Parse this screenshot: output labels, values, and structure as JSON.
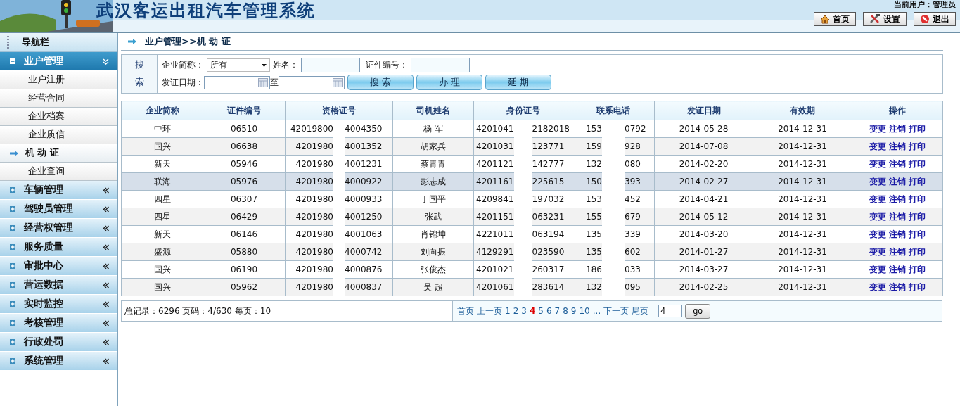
{
  "header": {
    "title": "武汉客运出租汽车管理系统",
    "user": "当前用户：管理员",
    "buttons": [
      {
        "kind": "home",
        "label": "首页"
      },
      {
        "kind": "settings",
        "label": "设置"
      },
      {
        "kind": "exit",
        "label": "退出"
      }
    ]
  },
  "sidebar": {
    "title": "导航栏",
    "groups": [
      {
        "label": "业户管理",
        "expanded": true,
        "children": [
          {
            "label": "业户注册",
            "selected": false
          },
          {
            "label": "经营合同",
            "selected": false
          },
          {
            "label": "企业档案",
            "selected": false
          },
          {
            "label": "企业质信",
            "selected": false
          },
          {
            "label": "机 动 证",
            "selected": true
          },
          {
            "label": "企业查询",
            "selected": false
          }
        ]
      },
      {
        "label": "车辆管理",
        "expanded": false
      },
      {
        "label": "驾驶员管理",
        "expanded": false
      },
      {
        "label": "经营权管理",
        "expanded": false
      },
      {
        "label": "服务质量",
        "expanded": false
      },
      {
        "label": "审批中心",
        "expanded": false
      },
      {
        "label": "营运数据",
        "expanded": false
      },
      {
        "label": "实时监控",
        "expanded": false
      },
      {
        "label": "考核管理",
        "expanded": false
      },
      {
        "label": "行政处罚",
        "expanded": false
      },
      {
        "label": "系统管理",
        "expanded": false
      }
    ]
  },
  "breadcrumb": "业户管理>>机 动 证",
  "search": {
    "label": "搜索",
    "company_label": "企业简称：",
    "company_value": "所有",
    "name_label": "姓名：",
    "cert_label": "证件编号：",
    "date_label": "发证日期：",
    "date_to": "至",
    "buttons": [
      "搜 索",
      "办 理",
      "延 期"
    ]
  },
  "table": {
    "columns": [
      "企业简称",
      "证件编号",
      "资格证号",
      "司机姓名",
      "身份证号",
      "联系电话",
      "发证日期",
      "有效期",
      "操作"
    ],
    "rows": [
      {
        "selected": false,
        "cells": [
          "中环",
          "06510",
          [
            "42019800",
            "4004350"
          ],
          "杨 军",
          [
            "4201041",
            "2182018"
          ],
          [
            "153",
            "0792"
          ],
          "2014-05-28",
          "2014-12-31"
        ],
        "actions": [
          "变更",
          "注销",
          "打印"
        ]
      },
      {
        "selected": false,
        "cells": [
          "国兴",
          "06638",
          [
            "4201980",
            "4001352"
          ],
          "胡家兵",
          [
            "4201031",
            "123771"
          ],
          [
            "159",
            "928"
          ],
          "2014-07-08",
          "2014-12-31"
        ],
        "actions": [
          "变更",
          "注销",
          "打印"
        ]
      },
      {
        "selected": false,
        "cells": [
          "新天",
          "05946",
          [
            "4201980",
            "4001231"
          ],
          "蔡青青",
          [
            "4201121",
            "142777"
          ],
          [
            "132",
            "080"
          ],
          "2014-02-20",
          "2014-12-31"
        ],
        "actions": [
          "变更",
          "注销",
          "打印"
        ]
      },
      {
        "selected": true,
        "cells": [
          "联海",
          "05976",
          [
            "4201980",
            "4000922"
          ],
          "彭志成",
          [
            "4201161",
            "225615"
          ],
          [
            "150",
            "393"
          ],
          "2014-02-27",
          "2014-12-31"
        ],
        "actions": [
          "变更",
          "注销",
          "打印"
        ]
      },
      {
        "selected": false,
        "cells": [
          "四星",
          "06307",
          [
            "4201980",
            "4000933"
          ],
          "丁国平",
          [
            "4209841",
            "197032"
          ],
          [
            "153",
            "452"
          ],
          "2014-04-21",
          "2014-12-31"
        ],
        "actions": [
          "变更",
          "注销",
          "打印"
        ]
      },
      {
        "selected": false,
        "cells": [
          "四星",
          "06429",
          [
            "4201980",
            "4001250"
          ],
          "张武",
          [
            "4201151",
            "063231"
          ],
          [
            "155",
            "679"
          ],
          "2014-05-12",
          "2014-12-31"
        ],
        "actions": [
          "变更",
          "注销",
          "打印"
        ]
      },
      {
        "selected": false,
        "cells": [
          "新天",
          "06146",
          [
            "4201980",
            "4001063"
          ],
          "肖锦坤",
          [
            "4221011",
            "063194"
          ],
          [
            "135",
            "339"
          ],
          "2014-03-20",
          "2014-12-31"
        ],
        "actions": [
          "变更",
          "注销",
          "打印"
        ]
      },
      {
        "selected": false,
        "cells": [
          "盛源",
          "05880",
          [
            "4201980",
            "4000742"
          ],
          "刘向振",
          [
            "4129291",
            "023590"
          ],
          [
            "135",
            "602"
          ],
          "2014-01-27",
          "2014-12-31"
        ],
        "actions": [
          "变更",
          "注销",
          "打印"
        ]
      },
      {
        "selected": false,
        "cells": [
          "国兴",
          "06190",
          [
            "4201980",
            "4000876"
          ],
          "张俊杰",
          [
            "4201021",
            "260317"
          ],
          [
            "186",
            "033"
          ],
          "2014-03-27",
          "2014-12-31"
        ],
        "actions": [
          "变更",
          "注销",
          "打印"
        ]
      },
      {
        "selected": false,
        "cells": [
          "国兴",
          "05962",
          [
            "4201980",
            "4000837"
          ],
          "吴 超",
          [
            "4201061",
            "283614"
          ],
          [
            "132",
            "095"
          ],
          "2014-02-25",
          "2014-12-31"
        ],
        "actions": [
          "变更",
          "注销",
          "打印"
        ]
      }
    ]
  },
  "pager": {
    "summary": "总记录：6296 页码：4/630 每页：10",
    "first": "首页",
    "prev": "上一页",
    "pages": [
      {
        "label": "1",
        "selected": false
      },
      {
        "label": "2",
        "selected": false
      },
      {
        "label": "3",
        "selected": false
      },
      {
        "label": "4",
        "selected": true
      },
      {
        "label": "5",
        "selected": false
      },
      {
        "label": "6",
        "selected": false
      },
      {
        "label": "7",
        "selected": false
      },
      {
        "label": "8",
        "selected": false
      },
      {
        "label": "9",
        "selected": false
      },
      {
        "label": "10",
        "selected": false
      }
    ],
    "more": "...",
    "next": "下一页",
    "last": "尾页",
    "page_input": "4",
    "go": "go"
  }
}
